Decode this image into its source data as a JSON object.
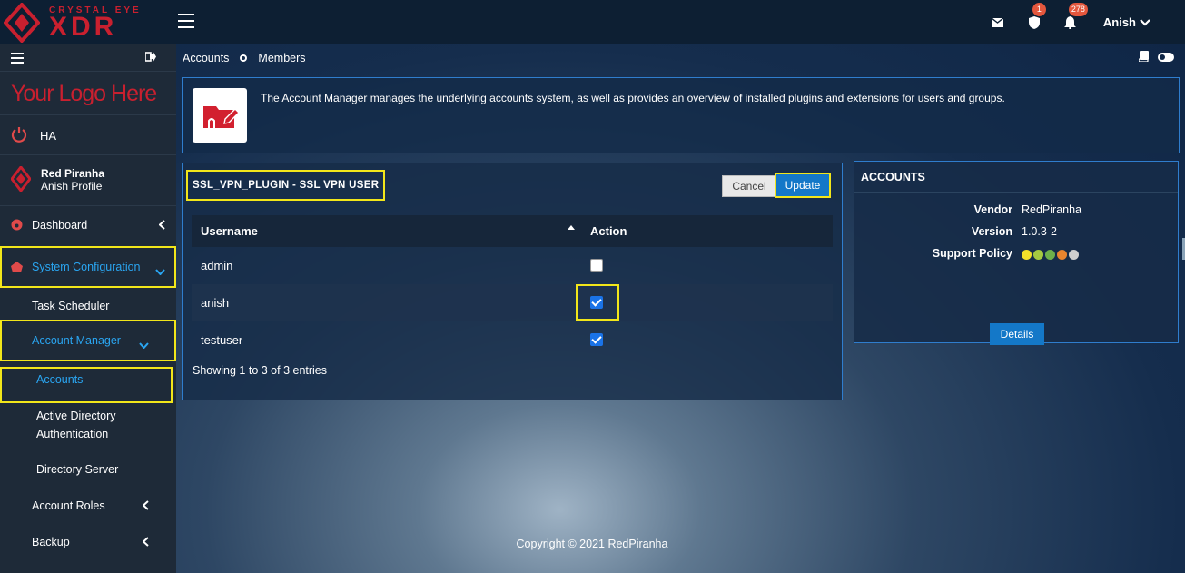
{
  "brand": {
    "tagline": "CRYSTAL EYE",
    "name": "XDR"
  },
  "topbar": {
    "mail_icon": "envelope-icon",
    "shield_badge": "1",
    "bell_badge": "278",
    "user": "Anish"
  },
  "sidebar": {
    "logo_text": "Your Logo Here",
    "ha_label": "HA",
    "profile_name": "Red Piranha",
    "profile_sub": "Anish Profile",
    "items": [
      {
        "label": "Dashboard"
      },
      {
        "label": "System Configuration"
      },
      {
        "label": "Task Scheduler"
      },
      {
        "label": "Account Manager"
      },
      {
        "label": "Accounts"
      },
      {
        "label": "Active Directory"
      },
      {
        "label": "Authentication"
      },
      {
        "label": "Directory Server"
      },
      {
        "label": "Account Roles"
      },
      {
        "label": "Backup"
      }
    ]
  },
  "breadcrumb": {
    "first": "Accounts",
    "second": "Members"
  },
  "info": {
    "text": "The Account Manager manages the underlying accounts system, as well as provides an overview of installed plugins and extensions for users and groups."
  },
  "plugin": {
    "title": "SSL_VPN_PLUGIN - SSL VPN USER",
    "cancel_label": "Cancel",
    "update_label": "Update",
    "columns": [
      "Username",
      "Action"
    ],
    "rows": [
      {
        "username": "admin",
        "checked": false
      },
      {
        "username": "anish",
        "checked": true
      },
      {
        "username": "testuser",
        "checked": true
      }
    ],
    "showing": "Showing 1 to 3 of 3 entries"
  },
  "accounts": {
    "title": "ACCOUNTS",
    "vendor_label": "Vendor",
    "vendor": "RedPiranha",
    "version_label": "Version",
    "version": "1.0.3-2",
    "support_label": "Support Policy",
    "support_dots": [
      "#f2e02a",
      "#a6c940",
      "#6fb04a",
      "#e8852e",
      "#cfcfcf"
    ],
    "details_label": "Details"
  },
  "footer": {
    "copyright": "Copyright © 2021 RedPiranha"
  }
}
